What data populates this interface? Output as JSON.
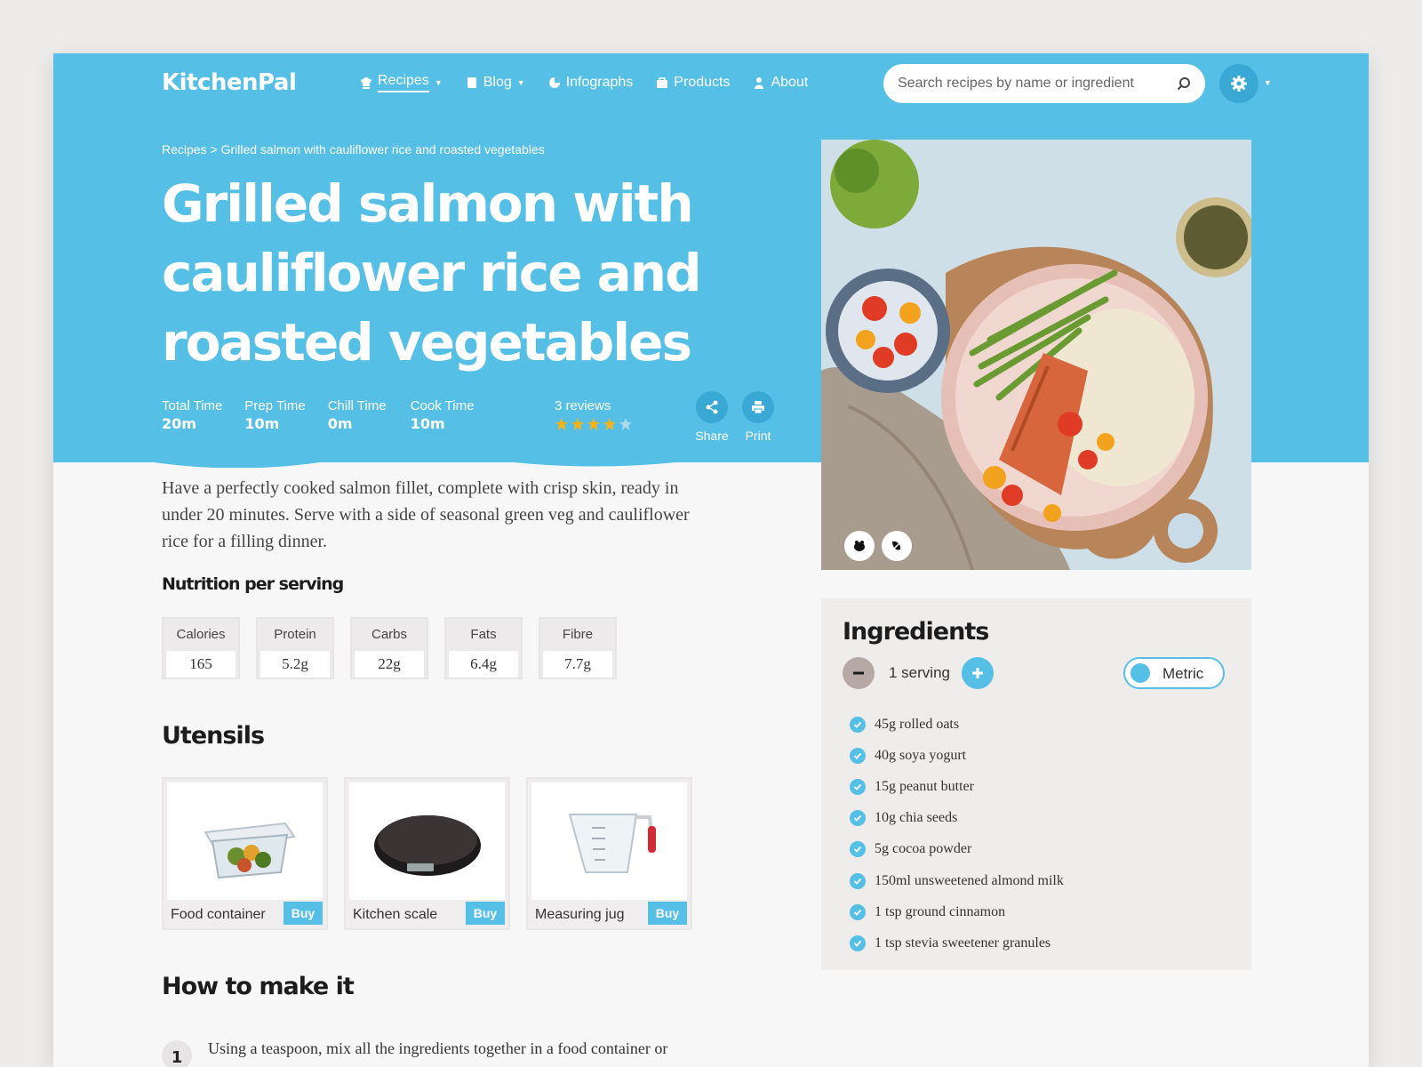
{
  "brand": {
    "logo": "KitchenPal",
    "accent": "#55bfe6",
    "accent_dark": "#3aa8d4"
  },
  "nav": [
    {
      "label": "Recipes",
      "icon": "chef-hat-icon",
      "dropdown": true,
      "active": true
    },
    {
      "label": "Blog",
      "icon": "notebook-icon",
      "dropdown": true
    },
    {
      "label": "Infographs",
      "icon": "pie-chart-icon"
    },
    {
      "label": "Products",
      "icon": "shopping-bag-icon"
    },
    {
      "label": "About",
      "icon": "person-icon"
    }
  ],
  "search": {
    "placeholder": "Search recipes by name or ingredient",
    "icon": "search-icon"
  },
  "settings": {
    "icon": "gear-icon"
  },
  "breadcrumb": {
    "root": "Recipes",
    "separator": ">",
    "current": "Grilled salmon with cauliflower rice and roasted vegetables"
  },
  "recipe": {
    "title_lines": [
      "Grilled salmon with",
      "cauliflower rice and",
      "roasted vegetables"
    ],
    "times": [
      {
        "label": "Total Time",
        "value": "20m"
      },
      {
        "label": "Prep Time",
        "value": "10m"
      },
      {
        "label": "Chill Time",
        "value": "0m"
      },
      {
        "label": "Cook Time",
        "value": "10m"
      }
    ],
    "reviews": {
      "label": "3 reviews",
      "rating": 4,
      "max": 5
    },
    "actions": {
      "share": "Share",
      "print": "Print"
    },
    "intro": "Have a perfectly cooked salmon fillet, complete with crisp skin, ready in under 20 minutes. Serve with a side of seasonal green veg and cauliflower rice for a filling dinner."
  },
  "nutrition": {
    "heading": "Nutrition per serving",
    "items": [
      {
        "label": "Calories",
        "value": "165"
      },
      {
        "label": "Protein",
        "value": "5.2g"
      },
      {
        "label": "Carbs",
        "value": "22g"
      },
      {
        "label": "Fats",
        "value": "6.4g"
      },
      {
        "label": "Fibre",
        "value": "7.7g"
      }
    ]
  },
  "utensils": {
    "heading": "Utensils",
    "buy_label": "Buy",
    "items": [
      {
        "label": "Food container",
        "icon": "food-container-icon"
      },
      {
        "label": "Kitchen scale",
        "icon": "kitchen-scale-icon"
      },
      {
        "label": "Measuring jug",
        "icon": "measuring-jug-icon"
      }
    ]
  },
  "method": {
    "heading": "How to make it",
    "steps": [
      {
        "number": "1",
        "text": "Using a teaspoon, mix all the ingredients together in a food container or"
      }
    ]
  },
  "ingredients": {
    "heading": "Ingredients",
    "servings": "1 serving",
    "unit_toggle": "Metric",
    "items": [
      "45g rolled oats",
      "40g soya yogurt",
      "15g peanut butter",
      "10g chia seeds",
      "5g cocoa powder",
      "150ml unsweetened almond milk",
      "1 tsp ground cinnamon",
      "1 tsp stevia sweetener granules"
    ]
  },
  "photo": {
    "badges": [
      "vegetarian-icon",
      "dairy-free-icon"
    ]
  }
}
